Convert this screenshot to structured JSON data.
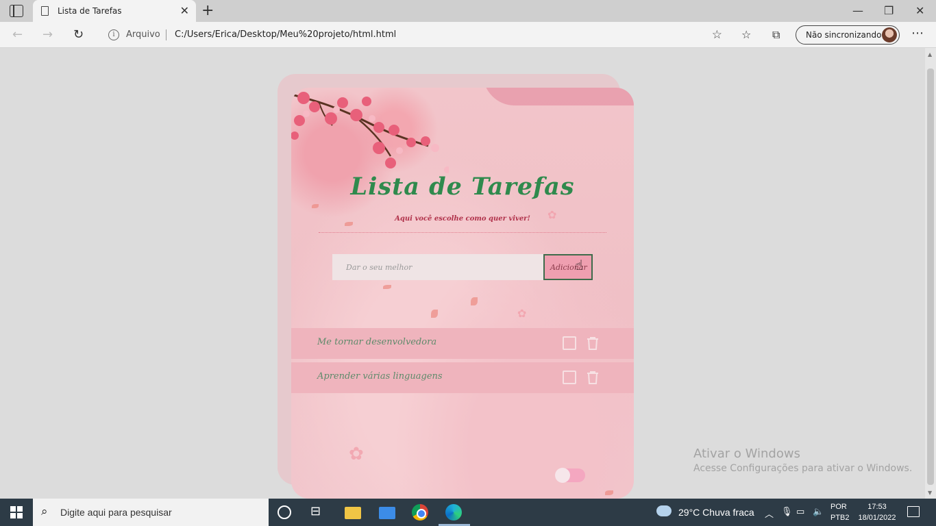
{
  "browser": {
    "tab_title": "Lista de Tarefas",
    "new_tab_glyph": "+",
    "address_scheme_label": "Arquivo",
    "url": "C:/Users/Erica/Desktop/Meu%20projeto/html.html",
    "profile_label": "Não sincronizando"
  },
  "app": {
    "title": "Lista de Tarefas",
    "subtitle": "Aqui você escolhe como quer viver!",
    "input_placeholder": "Dar o seu melhor",
    "add_button_label": "Adicionar",
    "tasks": [
      {
        "text": "Me tornar desenvolvedora",
        "done": false
      },
      {
        "text": "Aprender várias linguagens",
        "done": false
      }
    ],
    "theme_toggle_on": false,
    "accent_color": "#2f8a4d",
    "task_bg_color": "#efb4bd"
  },
  "watermark": {
    "line1": "Ativar o Windows",
    "line2": "Acesse Configurações para ativar o Windows."
  },
  "taskbar": {
    "search_placeholder": "Digite aqui para pesquisar",
    "weather": "29°C  Chuva fraca",
    "lang_top": "POR",
    "lang_bottom": "PTB2",
    "time": "17:53",
    "date": "18/01/2022"
  }
}
